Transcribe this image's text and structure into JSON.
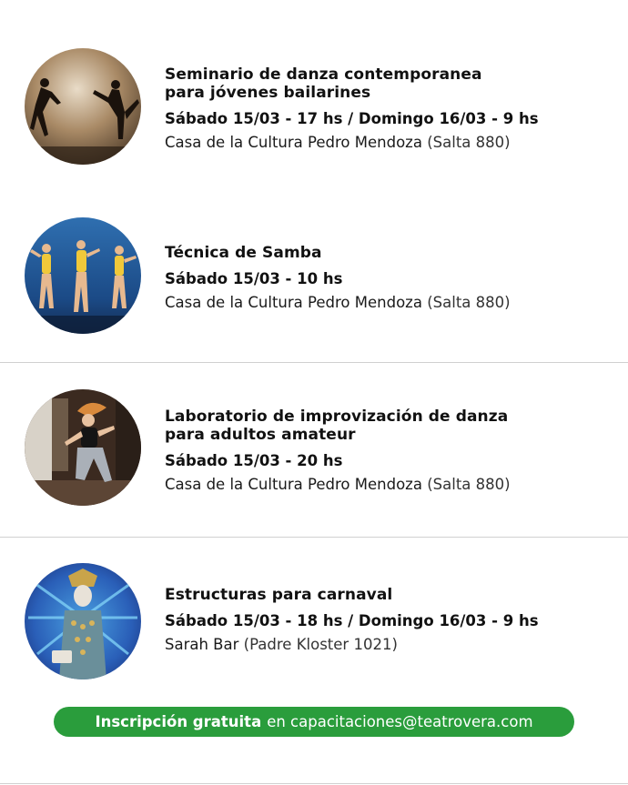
{
  "events": [
    {
      "title_line1": "Seminario de danza contemporanea",
      "title_line2": "para jóvenes bailarines",
      "date": "Sábado 15/03 - 17 hs / Domingo 16/03 - 9 hs",
      "venue": "Casa de la Cultura Pedro Mendoza",
      "address": "(Salta 880)"
    },
    {
      "title_line1": "Técnica de Samba",
      "title_line2": "",
      "date": "Sábado 15/03 - 10 hs",
      "venue": "Casa de la Cultura Pedro Mendoza",
      "address": "(Salta 880)"
    },
    {
      "title_line1": "Laboratorio de improvización de danza",
      "title_line2": "para adultos amateur",
      "date": "Sábado 15/03 - 20 hs",
      "venue": "Casa de la Cultura Pedro Mendoza",
      "address": "(Salta 880)"
    },
    {
      "title_line1": "Estructuras para carnaval",
      "title_line2": "",
      "date": "Sábado 15/03 - 18 hs / Domingo 16/03 - 9 hs",
      "venue": "Sarah Bar",
      "address": "(Padre Kloster 1021)"
    }
  ],
  "cta": {
    "bold": "Inscripción gratuita",
    "rest": "en capacitaciones@teatrovera.com"
  },
  "colors": {
    "accent_green": "#2a9d3c",
    "divider": "#d0d0d0"
  }
}
